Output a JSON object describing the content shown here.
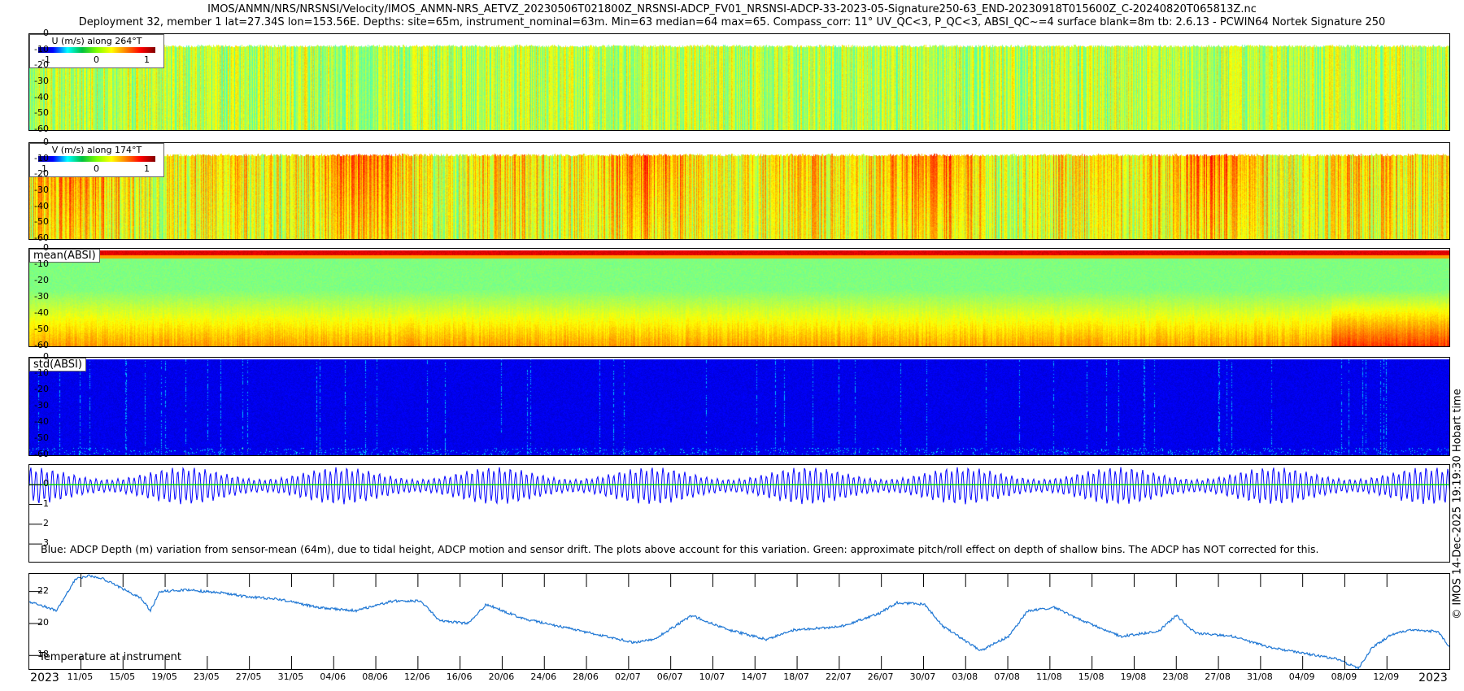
{
  "header": {
    "title": "IMOS/ANMN/NRS/NRSNSI/Velocity/IMOS_ANMN-NRS_AETVZ_20230506T021800Z_NRSNSI-ADCP_FV01_NRSNSI-ADCP-33-2023-05-Signature250-63_END-20230918T015600Z_C-20240820T065813Z.nc",
    "subtitle": "Deployment 32, member 1 lat=27.34S lon=153.56E. Depths: site=65m, instrument_nominal=63m. Min=63 median=64 max=65. Compass_corr: 11° UV_QC<3, P_QC<3, ABSI_QC~=4 surface blank=8m tb: 2.6.13 - PCWIN64 Nortek Signature 250"
  },
  "side_note": "© IMOS 14-Dec-2025 19:19:30 Hobart time",
  "chart_data": [
    {
      "type": "heatmap",
      "name": "U",
      "legend_title": "U (m/s) along 264°T",
      "colorbar_ticks": [
        "-1",
        "0",
        "1"
      ],
      "clim": [
        -1.2,
        1.2
      ],
      "y_ticks": [
        "0",
        "-10",
        "-20",
        "-30",
        "-40",
        "-50",
        "-60"
      ],
      "ylim": [
        -60,
        0
      ],
      "colormap": "jet",
      "blank_above": -8,
      "typical": 0.2,
      "variability": 0.25
    },
    {
      "type": "heatmap",
      "name": "V",
      "legend_title": "V (m/s) along 174°T",
      "colorbar_ticks": [
        "1",
        "0",
        "1"
      ],
      "clim": [
        -1.2,
        1.2
      ],
      "y_ticks": [
        "0",
        "-10",
        "-20",
        "-30",
        "-40",
        "-50",
        "-60"
      ],
      "ylim": [
        -60,
        0
      ],
      "colormap": "jet",
      "blank_above": -8,
      "typical": 0.35,
      "variability": 0.4
    },
    {
      "type": "heatmap",
      "name": "meanABSI",
      "label": "mean(ABSI)",
      "y_ticks": [
        "0",
        "-10",
        "-20",
        "-30",
        "-40",
        "-50",
        "-60"
      ],
      "ylim": [
        -60,
        0
      ],
      "colormap": "jet"
    },
    {
      "type": "heatmap",
      "name": "stdABSI",
      "label": "std(ABSI)",
      "y_ticks": [
        "0",
        "-10",
        "-20",
        "-30",
        "-40",
        "-50",
        "-60"
      ],
      "ylim": [
        -60,
        0
      ],
      "colormap": "jet"
    },
    {
      "type": "line",
      "name": "depth_variation",
      "y_ticks": [
        "0",
        "1",
        "2",
        "3"
      ],
      "ylim": [
        3.9,
        -1.0
      ],
      "note": "Blue: ADCP Depth (m) variation from sensor-mean (64m), due to tidal height, ADCP motion and sensor drift. The plots above account for this variation. Green: approximate pitch/roll effect on depth of shallow bins. The ADCP has NOT corrected for this.",
      "tidal_period_days": 0.5175,
      "spring_neap_days": 14.77,
      "amplitude_m": [
        0.3,
        0.85
      ],
      "colors": {
        "depth": "#0000ff",
        "pitch_roll": "#00dd00"
      }
    },
    {
      "type": "line",
      "name": "temperature",
      "label": "Temperature at instrument",
      "y_ticks": [
        "22",
        "20",
        "18"
      ],
      "ylim": [
        17.15,
        23.1
      ],
      "color": "#1f77d4",
      "x_days": [
        0.4,
        2.6,
        4.4,
        5.7,
        7.0,
        8.8,
        10.6,
        11.5,
        12.4,
        15.0,
        18.6,
        20.3,
        23.9,
        27.4,
        31.0,
        34.5,
        37.2,
        38.9,
        41.6,
        43.4,
        46.9,
        50.5,
        54.0,
        57.5,
        59.3,
        62.9,
        66.4,
        70.0,
        72.6,
        77.0,
        80.6,
        82.4,
        85.0,
        86.8,
        90.3,
        93.0,
        94.8,
        97.4,
        99.2,
        103.6,
        107.2,
        108.9,
        110.7,
        114.2,
        117.8,
        121.3,
        124.0,
        126.2,
        127.5,
        129.3,
        131.1,
        133.7,
        135.0
      ],
      "values": [
        21.3,
        20.8,
        22.8,
        23.0,
        22.8,
        22.2,
        21.6,
        20.8,
        22.0,
        22.1,
        21.9,
        21.7,
        21.5,
        21.0,
        20.8,
        21.4,
        21.4,
        20.2,
        20.0,
        21.2,
        20.3,
        19.8,
        19.3,
        18.8,
        19.0,
        20.5,
        19.6,
        19.0,
        19.6,
        19.8,
        20.6,
        21.3,
        21.2,
        19.8,
        18.3,
        19.2,
        20.8,
        21.0,
        20.4,
        19.2,
        19.5,
        20.5,
        19.4,
        19.2,
        18.5,
        18.1,
        17.8,
        17.2,
        18.5,
        19.3,
        19.6,
        19.5,
        18.4
      ]
    },
    {
      "type": "axis",
      "name": "time",
      "start_label": "2023",
      "end_label": "2023",
      "xlim_days": [
        0,
        134.98
      ],
      "first_tick_day": 4.9,
      "tick_step_days": 4,
      "tick_labels": [
        "11/05",
        "15/05",
        "19/05",
        "23/05",
        "27/05",
        "31/05",
        "04/06",
        "08/06",
        "12/06",
        "16/06",
        "20/06",
        "24/06",
        "28/06",
        "02/07",
        "06/07",
        "10/07",
        "14/07",
        "18/07",
        "22/07",
        "26/07",
        "30/07",
        "03/08",
        "07/08",
        "11/08",
        "15/08",
        "19/08",
        "23/08",
        "27/08",
        "31/08",
        "04/09",
        "08/09",
        "12/09"
      ]
    }
  ]
}
